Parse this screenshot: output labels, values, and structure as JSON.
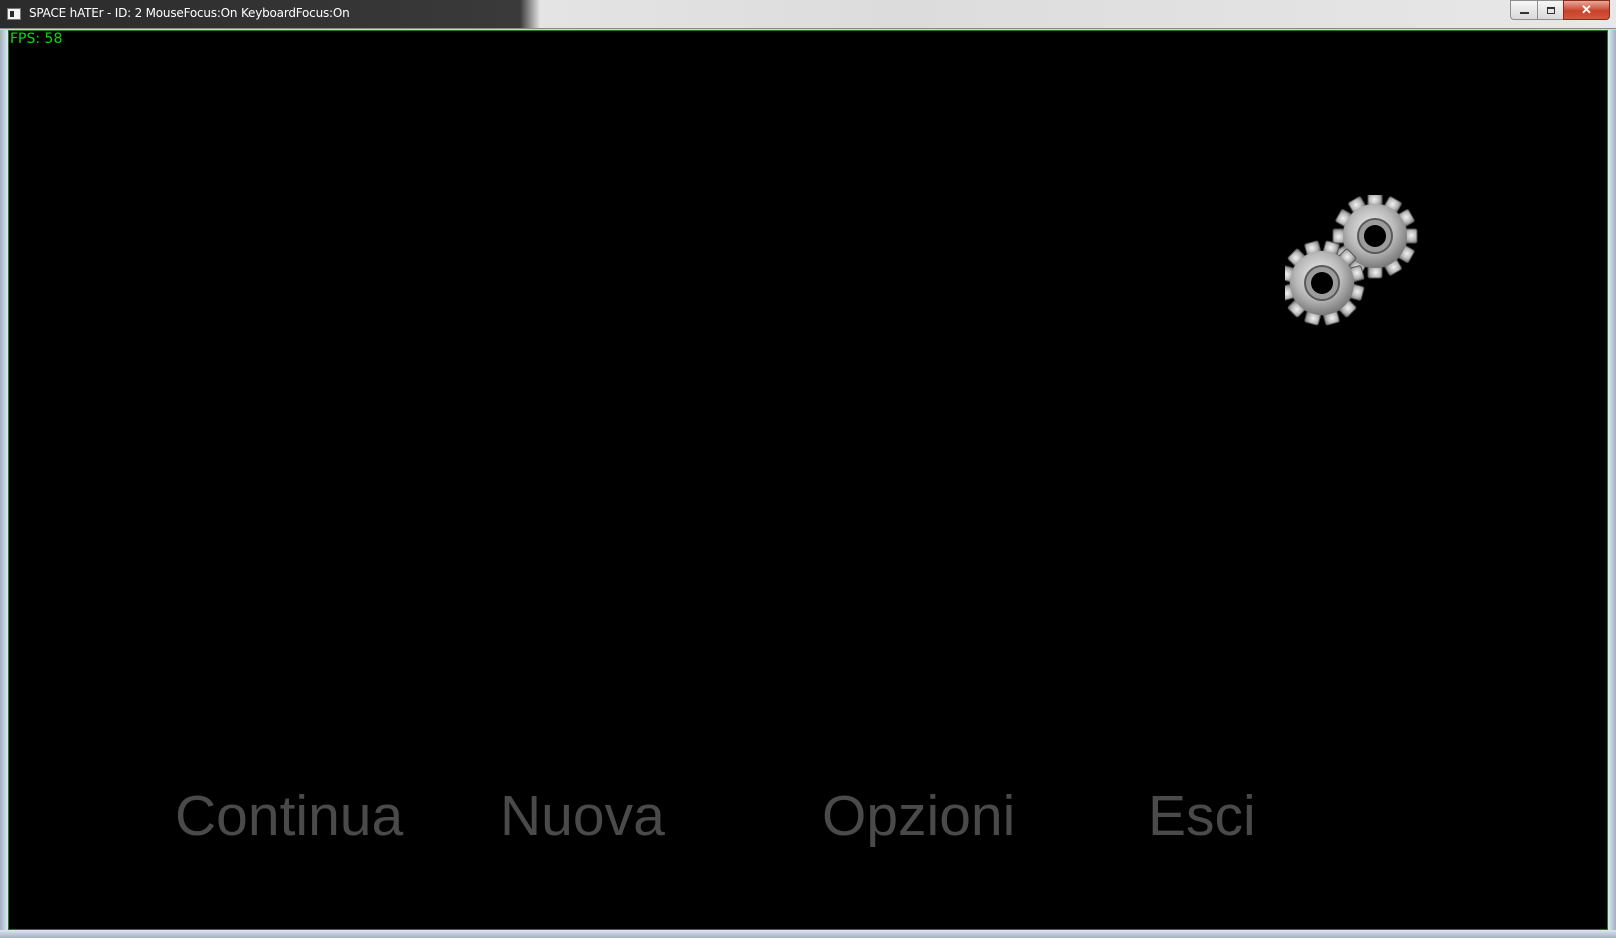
{
  "window": {
    "title": "SPACE hATEr - ID: 2 MouseFocus:On KeyboardFocus:On",
    "controls": {
      "minimize_icon": "minimize-icon",
      "maximize_icon": "maximize-icon",
      "close_label": "✕"
    }
  },
  "hud": {
    "fps_text": "FPS: 58",
    "fps_color": "#00e000"
  },
  "loading_indicator": {
    "icon": "gears-icon"
  },
  "menu": {
    "items": [
      {
        "label": "Continua"
      },
      {
        "label": "Nuova"
      },
      {
        "label": "Opzioni"
      },
      {
        "label": "Esci"
      }
    ],
    "text_color": "#4a4a4a"
  },
  "colors": {
    "background": "#000000",
    "border": "#1f7a1f"
  }
}
